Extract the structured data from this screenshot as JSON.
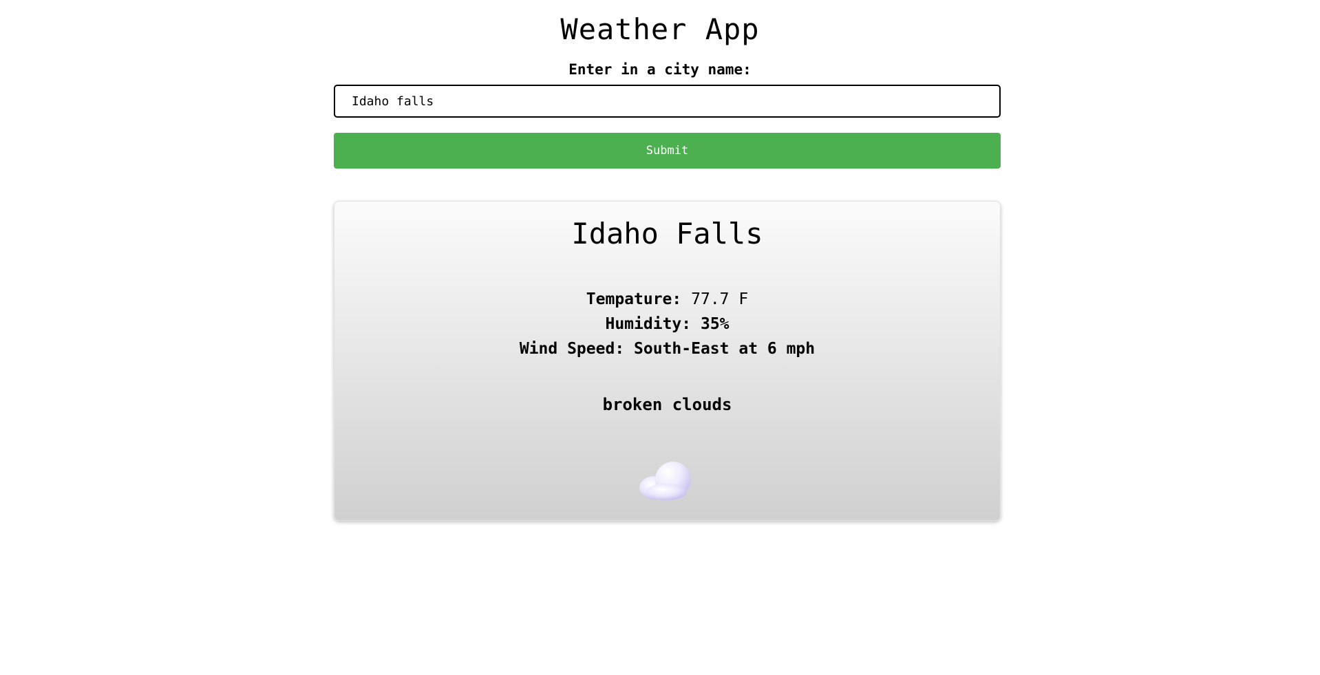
{
  "header": {
    "title": "Weather App",
    "city_label": "Enter in a city name:"
  },
  "search": {
    "value": "Idaho falls",
    "submit_label": "Submit"
  },
  "colors": {
    "submit_bg": "#4caf50",
    "card_gradient_top": "#fbfbfb",
    "card_gradient_bottom": "#d0d0d0"
  },
  "result": {
    "city": "Idaho Falls",
    "temperature_label": "Tempature:",
    "temperature_value": "77.7 F",
    "humidity_label": "Humidity:",
    "humidity_value": "35%",
    "wind_label": "Wind Speed:",
    "wind_value": "South-East at 6 mph",
    "description": "broken clouds",
    "icon": "broken-clouds-icon"
  }
}
